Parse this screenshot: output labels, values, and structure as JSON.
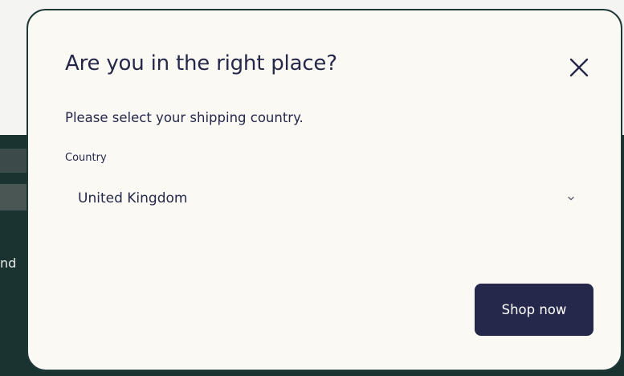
{
  "background": {
    "fragment_text": "nd"
  },
  "modal": {
    "title": "Are you in the right place?",
    "close_icon": "close-icon",
    "subtitle": "Please select your shipping country.",
    "country_field": {
      "label": "Country",
      "selected_value": "United Kingdom",
      "icon": "chevron-down-icon"
    },
    "shop_button_label": "Shop now"
  },
  "colors": {
    "primary": "#25284a",
    "modal_background": "#fbf9f4",
    "page_dark": "#1b3330",
    "page_light": "#f4f4f2"
  }
}
